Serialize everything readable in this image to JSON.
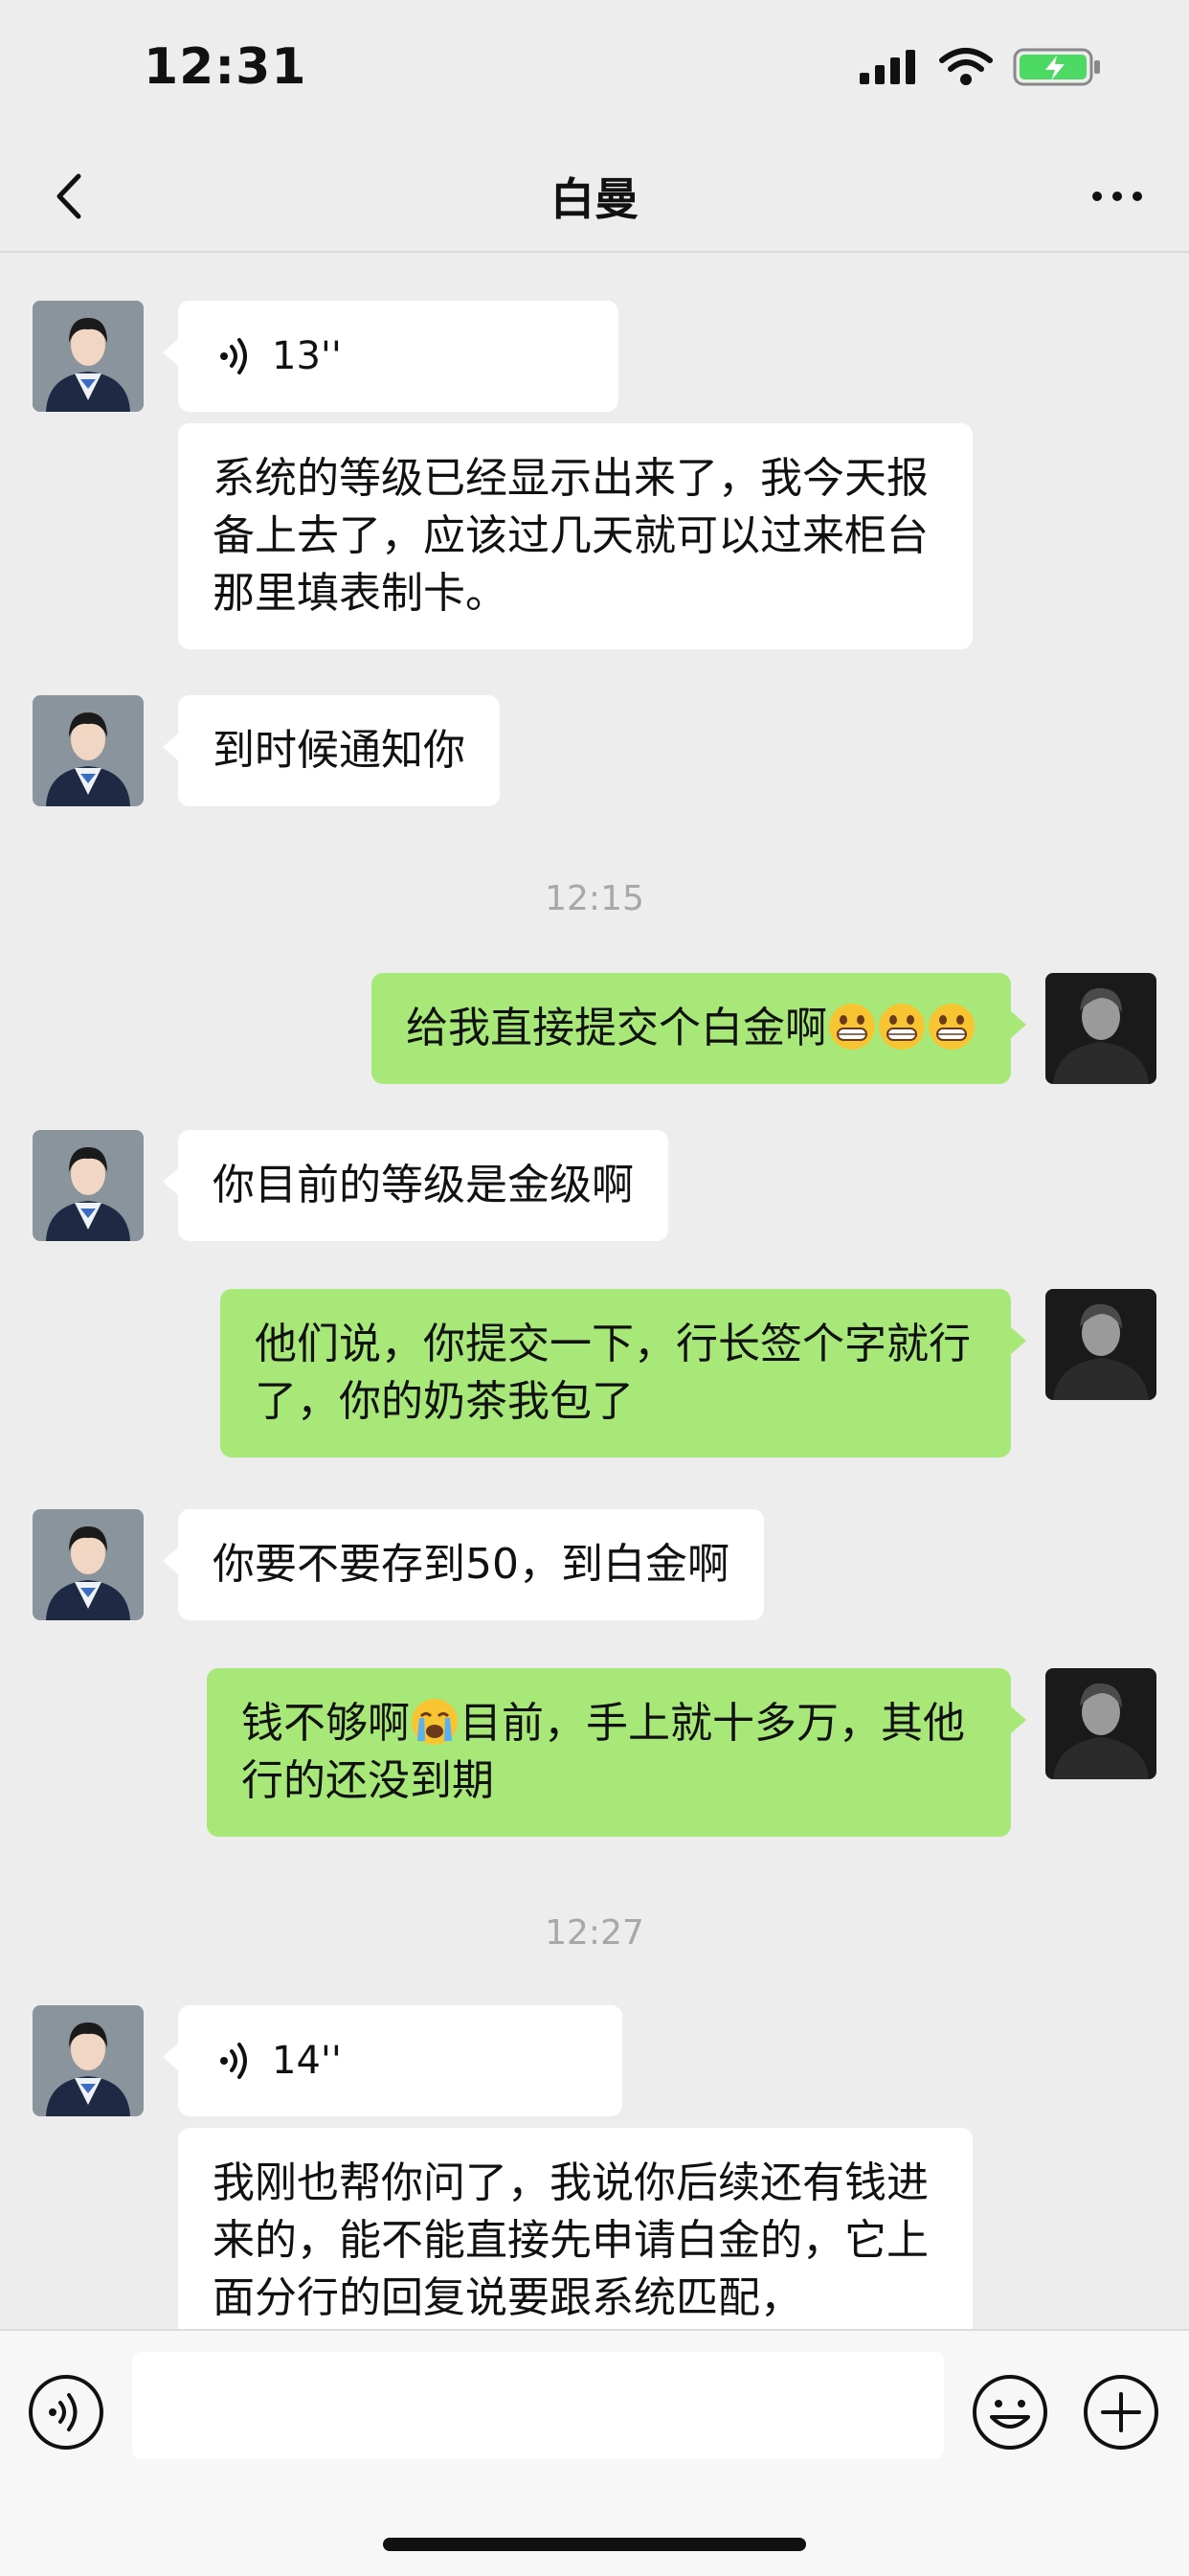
{
  "status_bar": {
    "time": "12:31"
  },
  "nav": {
    "title": "白曼"
  },
  "messages": {
    "m1_voice": "13''",
    "m2_text": "系统的等级已经显示出来了，我今天报备上去了，应该过几天就可以过来柜台那里填表制卡。",
    "m3_text": "到时候通知你",
    "ts1": "12:15",
    "m4_text": "给我直接提交个白金啊",
    "m5_text": "你目前的等级是金级啊",
    "m6_text": "他们说，你提交一下，行长签个字就行了，你的奶茶我包了",
    "m7_text": "你要不要存到50，到白金啊",
    "m8_text_a": "钱不够啊",
    "m8_text_b": "目前，手上就十多万，其他行的还没到期",
    "ts2": "12:27",
    "m9_voice": "14''",
    "m10_text": "我刚也帮你问了，我说你后续还有钱进来的，能不能直接先申请白金的，它上面分行的回复说要跟系统匹配，"
  },
  "colors": {
    "sent_bubble": "#a8e879",
    "received_bubble": "#ffffff",
    "background": "#ededed"
  },
  "icons": {
    "back": "back-arrow-icon",
    "more": "more-dots-icon",
    "voice_msg": "voice-wave-icon",
    "input_voice": "voice-input-icon",
    "emoji": "emoji-icon",
    "plus": "plus-icon"
  }
}
